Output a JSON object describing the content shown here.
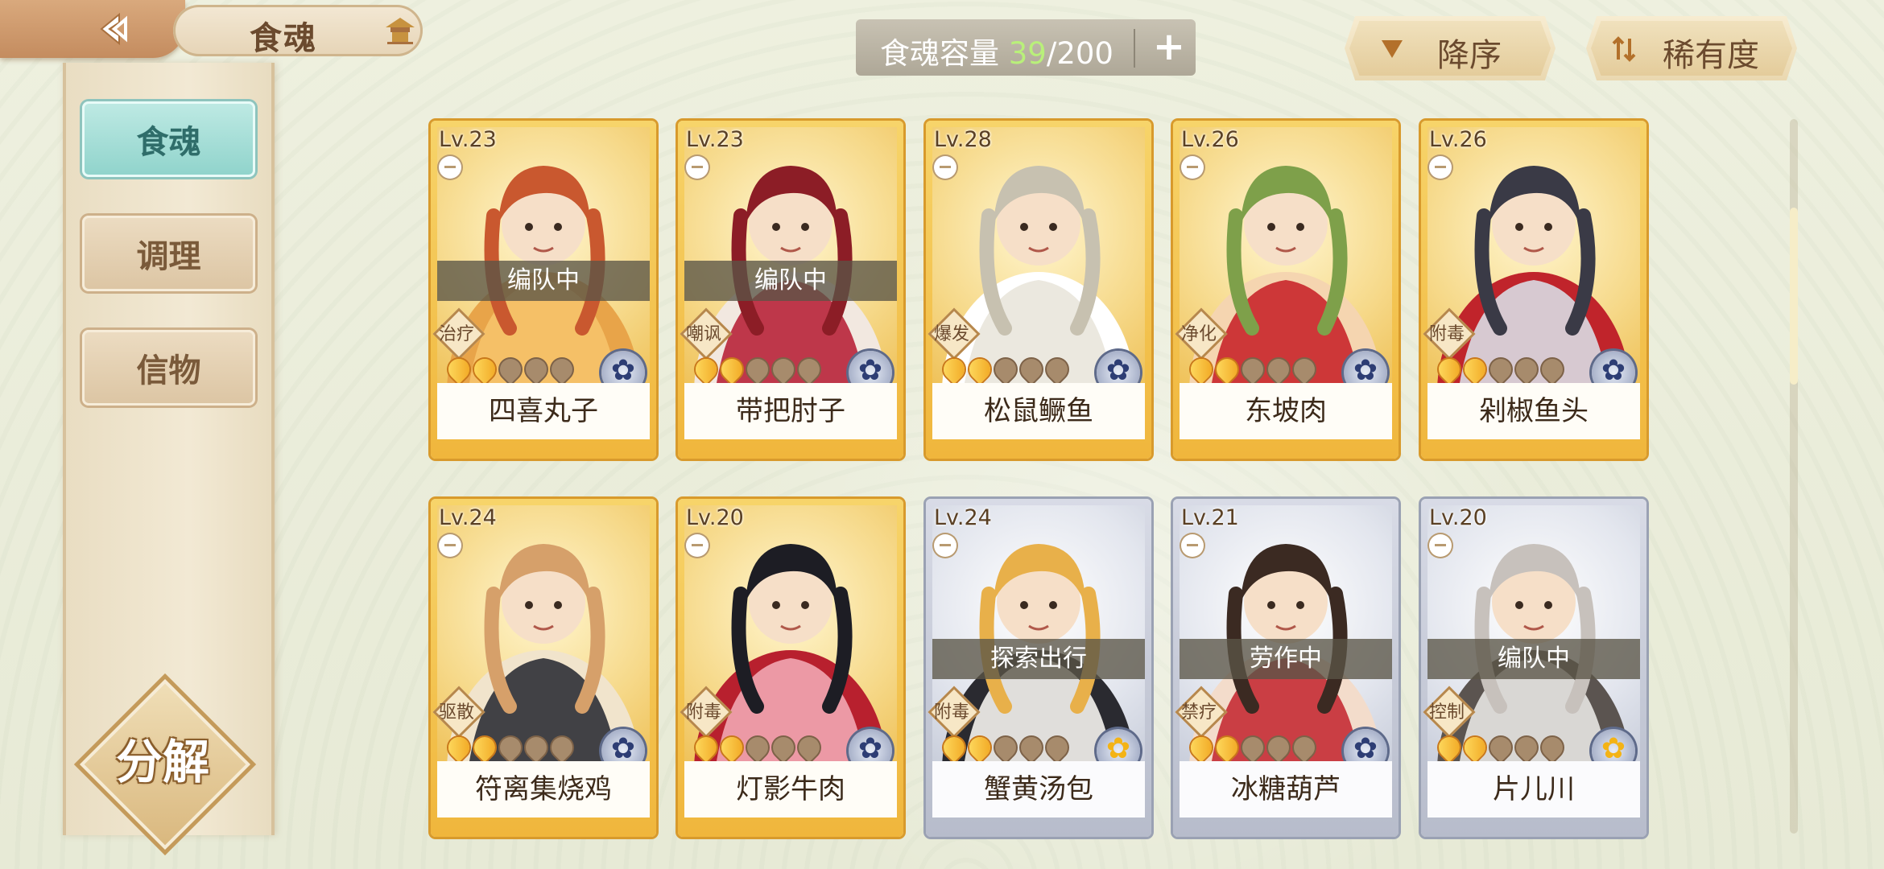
{
  "header": {
    "title": "食魂"
  },
  "capacity": {
    "label": "食魂容量 ",
    "current": "39",
    "max": "/200",
    "add_label": "+"
  },
  "sort": {
    "order_label": "降序",
    "rarity_label": "稀有度"
  },
  "sidebar": {
    "items": [
      {
        "label": "食魂",
        "active": true
      },
      {
        "label": "调理",
        "active": false
      },
      {
        "label": "信物",
        "active": false
      }
    ],
    "decompose_label": "分解"
  },
  "cards": [
    {
      "level": "Lv.23",
      "name": "四喜丸子",
      "status": "编队中",
      "tag": "治疗",
      "stars_on": 2,
      "stars_total": 5,
      "frame": "gold",
      "element": "blue"
    },
    {
      "level": "Lv.23",
      "name": "带把肘子",
      "status": "编队中",
      "tag": "嘲讽",
      "stars_on": 2,
      "stars_total": 5,
      "frame": "gold",
      "element": "blue"
    },
    {
      "level": "Lv.28",
      "name": "松鼠鳜鱼",
      "status": "",
      "tag": "爆发",
      "stars_on": 2,
      "stars_total": 5,
      "frame": "gold",
      "element": "blue"
    },
    {
      "level": "Lv.26",
      "name": "东坡肉",
      "status": "",
      "tag": "净化",
      "stars_on": 2,
      "stars_total": 5,
      "frame": "gold",
      "element": "blue"
    },
    {
      "level": "Lv.26",
      "name": "剁椒鱼头",
      "status": "",
      "tag": "附毒",
      "stars_on": 2,
      "stars_total": 5,
      "frame": "gold",
      "element": "blue"
    },
    {
      "level": "Lv.24",
      "name": "符离集烧鸡",
      "status": "",
      "tag": "驱散",
      "stars_on": 2,
      "stars_total": 5,
      "frame": "gold",
      "element": "blue"
    },
    {
      "level": "Lv.20",
      "name": "灯影牛肉",
      "status": "",
      "tag": "附毒",
      "stars_on": 2,
      "stars_total": 5,
      "frame": "gold",
      "element": "blue"
    },
    {
      "level": "Lv.24",
      "name": "蟹黄汤包",
      "status": "探索出行",
      "tag": "附毒",
      "stars_on": 2,
      "stars_total": 5,
      "frame": "silver",
      "element": "yellow"
    },
    {
      "level": "Lv.21",
      "name": "冰糖葫芦",
      "status": "劳作中",
      "tag": "禁疗",
      "stars_on": 2,
      "stars_total": 5,
      "frame": "silver",
      "element": "blue"
    },
    {
      "level": "Lv.20",
      "name": "片儿川",
      "status": "编队中",
      "tag": "控制",
      "stars_on": 2,
      "stars_total": 5,
      "frame": "silver",
      "element": "yellow"
    }
  ],
  "colors": {
    "accent_active_tab": "#8fd3cb",
    "gold_frame": "#f0b63c",
    "silver_frame": "#b7bccb",
    "capacity_current": "#b9f07a"
  }
}
